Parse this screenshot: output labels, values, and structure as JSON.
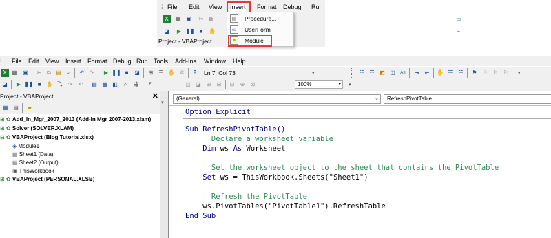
{
  "popup": {
    "menu": [
      "File",
      "Edit",
      "View",
      "Insert",
      "Format",
      "Debug",
      "Run"
    ],
    "panel_title": "Project - VBAProject",
    "insert_items": [
      "Procedure...",
      "UserForm",
      "Module"
    ]
  },
  "menubar": [
    "File",
    "Edit",
    "View",
    "Insert",
    "Format",
    "Debug",
    "Run",
    "Tools",
    "Add-Ins",
    "Window",
    "Help"
  ],
  "toolbar": {
    "position": "Ln 7, Col 73",
    "zoom": "100%"
  },
  "project": {
    "title": "Project - VBAProject",
    "close": "✕",
    "nodes": [
      "Add_In_Mgr_2007_2013 (Add-In Mgr 2007-2013.xlam)",
      "Solver (SOLVER.XLAM)",
      "VBAProject (Blog Tutorial.xlsx)",
      "Module1",
      "Sheet1 (Data)",
      "Sheet2 (Output)",
      "ThisWorkbook",
      "VBAProject (PERSONAL.XLSB)"
    ]
  },
  "code": {
    "object_combo": "(General)",
    "proc_combo": "RefreshPivotTable",
    "line1": "Option Explicit",
    "line2": "Sub RefreshPivotTable()",
    "line3": "    ' Declare a worksheet variable",
    "line4_kw1": "Dim",
    "line4_mid": " ws ",
    "line4_kw2": "As",
    "line4_end": " Worksheet",
    "line5": "    ' Set the worksheet object to the sheet that contains the PivotTable",
    "line6_kw": "Set",
    "line6_rest": " ws = ThisWorkbook.Sheets(\"Sheet1\")",
    "line7": "    ' Refresh the PivotTable",
    "line8": "    ws.PivotTables(\"PivotTable1\").RefreshTable",
    "line9": "End Sub"
  }
}
